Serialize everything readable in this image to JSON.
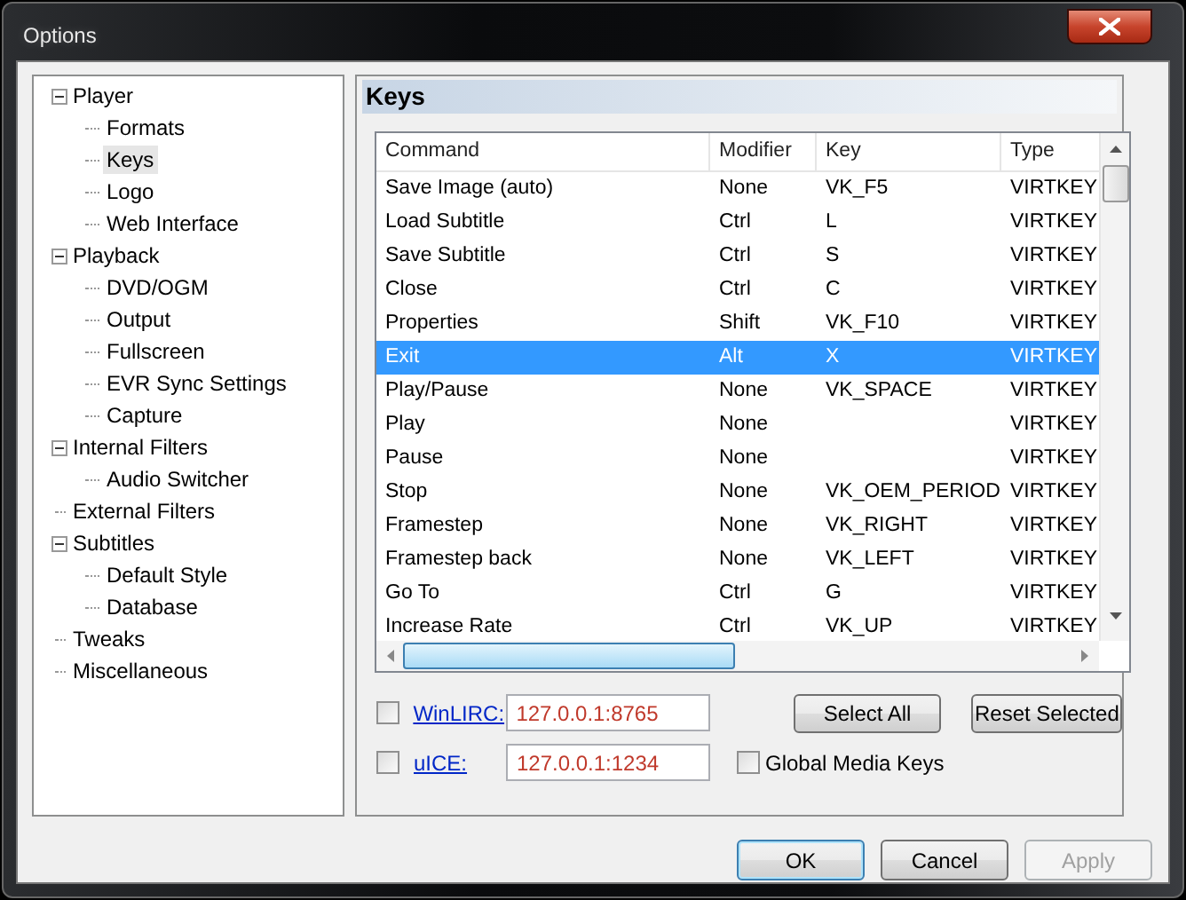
{
  "window": {
    "title": "Options"
  },
  "tree": [
    {
      "label": "Player",
      "expanded": true,
      "selected": false,
      "children": [
        {
          "label": "Formats",
          "selected": false
        },
        {
          "label": "Keys",
          "selected": true
        },
        {
          "label": "Logo",
          "selected": false
        },
        {
          "label": "Web Interface",
          "selected": false
        }
      ]
    },
    {
      "label": "Playback",
      "expanded": true,
      "selected": false,
      "children": [
        {
          "label": "DVD/OGM",
          "selected": false
        },
        {
          "label": "Output",
          "selected": false
        },
        {
          "label": "Fullscreen",
          "selected": false
        },
        {
          "label": "EVR Sync Settings",
          "selected": false
        },
        {
          "label": "Capture",
          "selected": false
        }
      ]
    },
    {
      "label": "Internal Filters",
      "expanded": true,
      "selected": false,
      "children": [
        {
          "label": "Audio Switcher",
          "selected": false
        }
      ]
    },
    {
      "label": "External Filters",
      "selected": false
    },
    {
      "label": "Subtitles",
      "expanded": true,
      "selected": false,
      "children": [
        {
          "label": "Default Style",
          "selected": false
        },
        {
          "label": "Database",
          "selected": false
        }
      ]
    },
    {
      "label": "Tweaks",
      "selected": false
    },
    {
      "label": "Miscellaneous",
      "selected": false
    }
  ],
  "page_title": "Keys",
  "table": {
    "columns": [
      "Command",
      "Modifier",
      "Key",
      "Type"
    ],
    "rows": [
      {
        "cells": [
          "Save Image (auto)",
          "None",
          "VK_F5",
          "VIRTKEY"
        ],
        "selected": false
      },
      {
        "cells": [
          "Load Subtitle",
          "Ctrl",
          "L",
          "VIRTKEY"
        ],
        "selected": false
      },
      {
        "cells": [
          "Save Subtitle",
          "Ctrl",
          "S",
          "VIRTKEY"
        ],
        "selected": false
      },
      {
        "cells": [
          "Close",
          "Ctrl",
          "C",
          "VIRTKEY"
        ],
        "selected": false
      },
      {
        "cells": [
          "Properties",
          "Shift",
          "VK_F10",
          "VIRTKEY"
        ],
        "selected": false
      },
      {
        "cells": [
          "Exit",
          "Alt",
          "X",
          "VIRTKEY"
        ],
        "selected": true
      },
      {
        "cells": [
          "Play/Pause",
          "None",
          "VK_SPACE",
          "VIRTKEY"
        ],
        "selected": false
      },
      {
        "cells": [
          "Play",
          "None",
          "",
          "VIRTKEY"
        ],
        "selected": false
      },
      {
        "cells": [
          "Pause",
          "None",
          "",
          "VIRTKEY"
        ],
        "selected": false
      },
      {
        "cells": [
          "Stop",
          "None",
          "VK_OEM_PERIOD",
          "VIRTKEY"
        ],
        "selected": false
      },
      {
        "cells": [
          "Framestep",
          "None",
          "VK_RIGHT",
          "VIRTKEY"
        ],
        "selected": false
      },
      {
        "cells": [
          "Framestep back",
          "None",
          "VK_LEFT",
          "VIRTKEY"
        ],
        "selected": false
      },
      {
        "cells": [
          "Go To",
          "Ctrl",
          "G",
          "VIRTKEY"
        ],
        "selected": false
      },
      {
        "cells": [
          "Increase Rate",
          "Ctrl",
          "VK_UP",
          "VIRTKEY"
        ],
        "selected": false
      }
    ]
  },
  "remotes": [
    {
      "checked": false,
      "link": "WinLIRC:",
      "value": "127.0.0.1:8765"
    },
    {
      "checked": false,
      "link": "uICE:",
      "value": "127.0.0.1:1234"
    }
  ],
  "list_buttons": [
    "Select All",
    "Reset Selected"
  ],
  "global_media_keys": {
    "label": "Global Media Keys",
    "checked": false
  },
  "dialog_buttons": [
    {
      "label": "OK",
      "default": true,
      "disabled": false
    },
    {
      "label": "Cancel",
      "default": false,
      "disabled": false
    },
    {
      "label": "Apply",
      "default": false,
      "disabled": true
    }
  ]
}
